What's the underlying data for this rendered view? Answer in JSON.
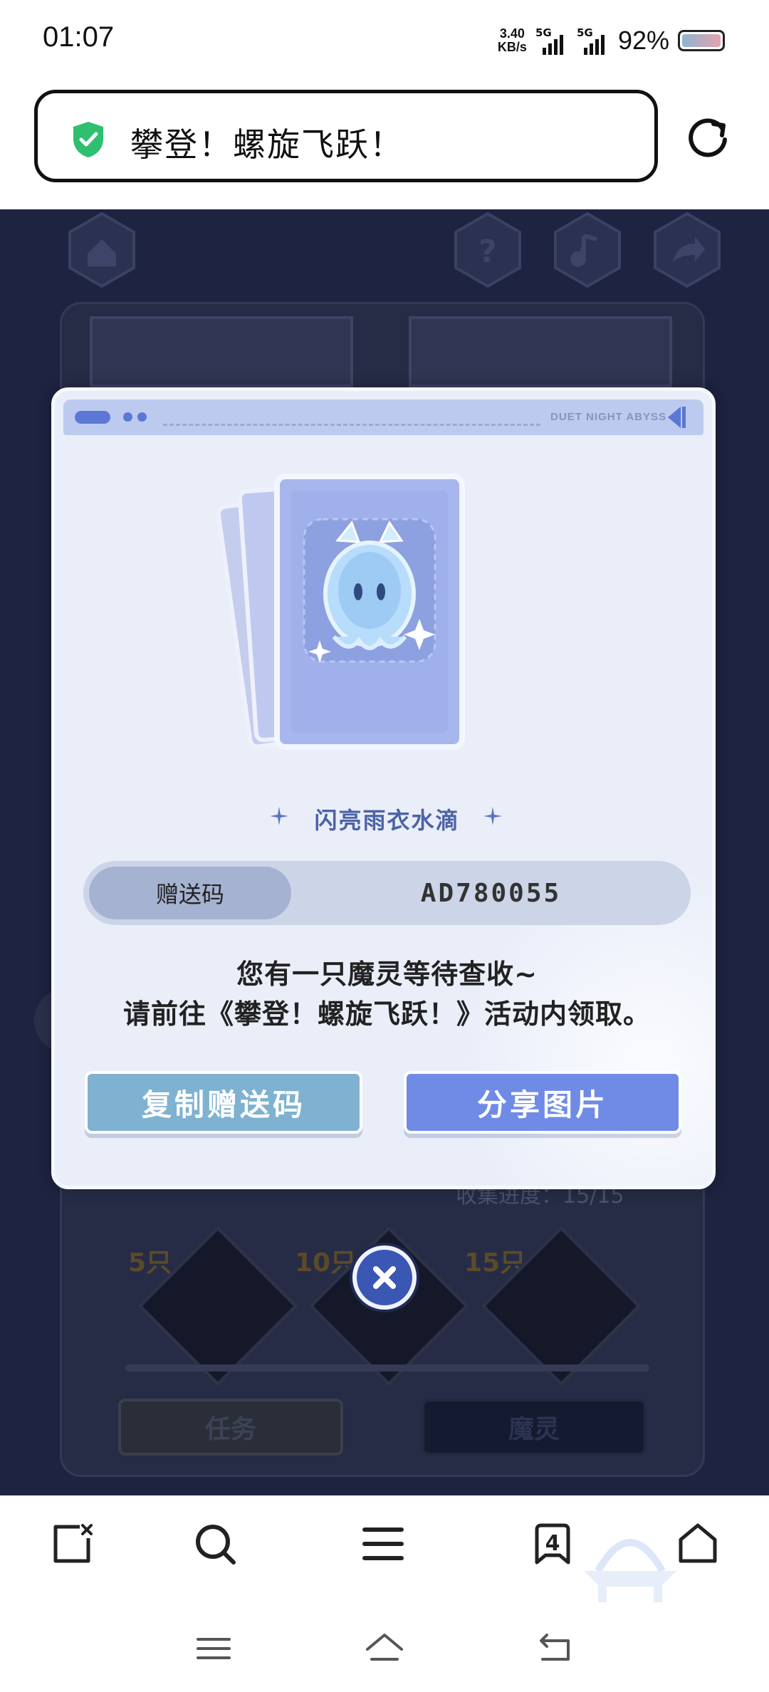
{
  "status_bar": {
    "time": "01:07",
    "net_speed_value": "3.40",
    "net_speed_unit": "KB/s",
    "sim1": "5G",
    "sim2": "5G",
    "battery": "92%"
  },
  "browser": {
    "page_title": "攀登！螺旋飞跃！",
    "tab_count": "4"
  },
  "modal": {
    "header_text": "DUET NIGHT ABYSS",
    "item_name": "闪亮雨衣水滴",
    "code_label": "赠送码",
    "code_value": "AD780055",
    "message_line1": "您有一只魔灵等待查收~",
    "message_line2": "请前往《攀登！螺旋飞跃！》活动内领取。",
    "copy_button": "复制赠送码",
    "share_button": "分享图片"
  },
  "background": {
    "progress_text": "收集进度：15/15",
    "milestones": [
      "5只",
      "10只",
      "15只"
    ],
    "tab_task": "任务",
    "tab_spirit": "魔灵"
  },
  "colors": {
    "accent_blue": "#6f8be6",
    "copy_button": "#7fb1d1",
    "modal_bg": "#e9eef9",
    "shield_green": "#2fbf71"
  },
  "icons": [
    "shield-check-icon",
    "reload-icon",
    "home-icon",
    "help-icon",
    "music-icon",
    "share-icon",
    "close-icon",
    "new-tab-icon",
    "search-icon",
    "menu-icon",
    "tabs-icon",
    "home-outline-icon"
  ]
}
